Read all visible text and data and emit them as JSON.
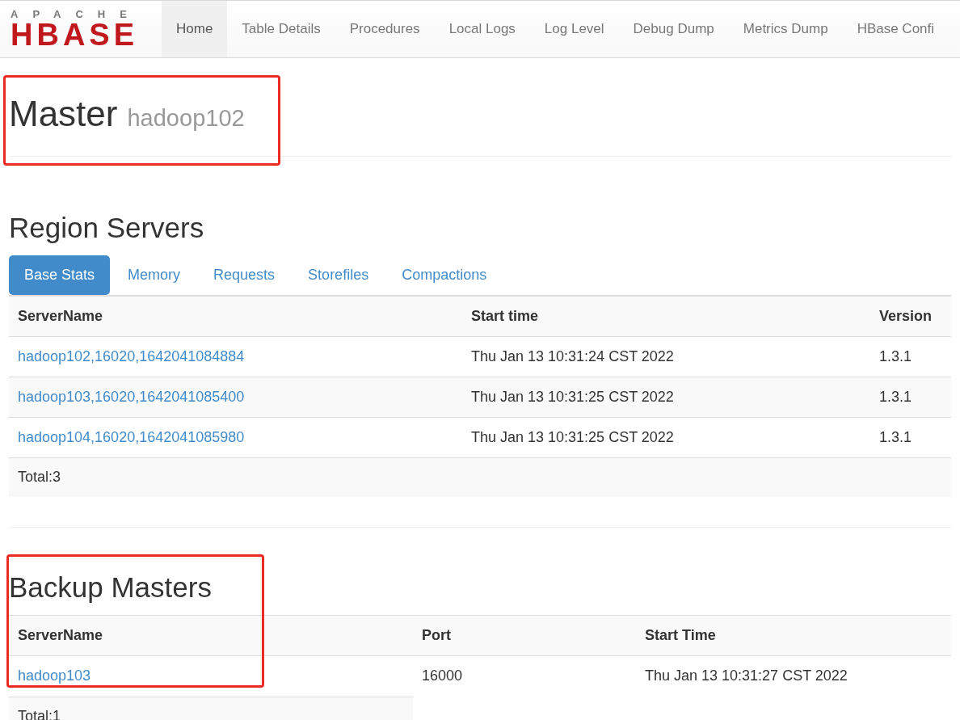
{
  "logo": {
    "top": "APACHE",
    "main": "HBASE"
  },
  "nav": [
    {
      "label": "Home",
      "selected": true
    },
    {
      "label": "Table Details",
      "selected": false
    },
    {
      "label": "Procedures",
      "selected": false
    },
    {
      "label": "Local Logs",
      "selected": false
    },
    {
      "label": "Log Level",
      "selected": false
    },
    {
      "label": "Debug Dump",
      "selected": false
    },
    {
      "label": "Metrics Dump",
      "selected": false
    },
    {
      "label": "HBase Confi",
      "selected": false
    }
  ],
  "master": {
    "title": "Master",
    "host": "hadoop102"
  },
  "region_servers": {
    "title": "Region Servers",
    "tabs": [
      {
        "label": "Base Stats",
        "selected": true
      },
      {
        "label": "Memory",
        "selected": false
      },
      {
        "label": "Requests",
        "selected": false
      },
      {
        "label": "Storefiles",
        "selected": false
      },
      {
        "label": "Compactions",
        "selected": false
      }
    ],
    "columns": [
      "ServerName",
      "Start time",
      "Version"
    ],
    "rows": [
      [
        "hadoop102,16020,1642041084884",
        "Thu Jan 13 10:31:24 CST 2022",
        "1.3.1"
      ],
      [
        "hadoop103,16020,1642041085400",
        "Thu Jan 13 10:31:25 CST 2022",
        "1.3.1"
      ],
      [
        "hadoop104,16020,1642041085980",
        "Thu Jan 13 10:31:25 CST 2022",
        "1.3.1"
      ]
    ],
    "total": "Total:3"
  },
  "backup_masters": {
    "title": "Backup Masters",
    "columns": [
      "ServerName",
      "Port",
      "Start Time"
    ],
    "rows": [
      [
        "hadoop103",
        "16000",
        "Thu Jan 13 10:31:27 CST 2022"
      ]
    ],
    "total": "Total:1"
  }
}
